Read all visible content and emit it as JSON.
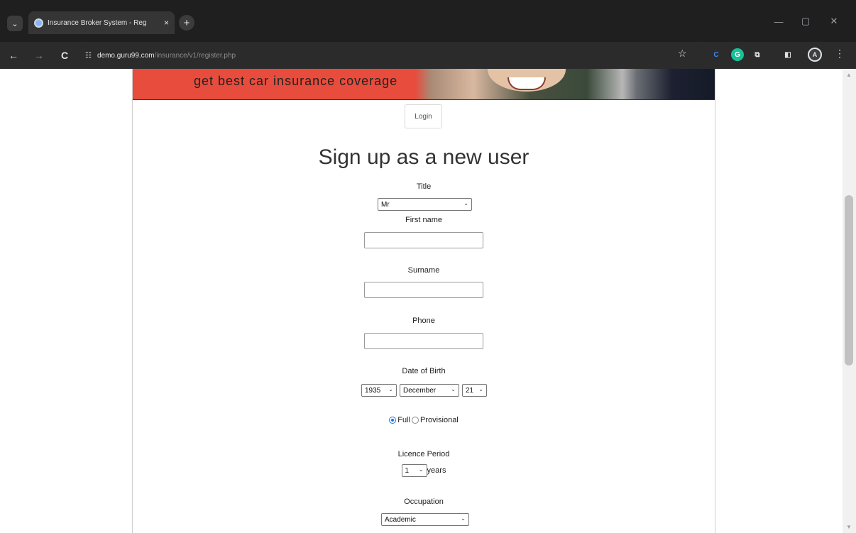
{
  "browser": {
    "tab_title": "Insurance Broker System - Reg",
    "tab_close": "×",
    "new_tab": "+",
    "url_host": "demo.guru99.com",
    "url_path": "/insurance/v1/register.php",
    "icons": {
      "back": "←",
      "forward": "→",
      "reload": "C",
      "site_info": "☷",
      "bookmark": "☆",
      "menu": "⋮",
      "minimize": "—",
      "maximize": "▢",
      "close": "✕"
    },
    "extensions": {
      "c": "C",
      "g": "G",
      "puzzle": "⧉",
      "sidepanel": "◧",
      "avatar": "A"
    }
  },
  "banner": {
    "text": "get best car insurance coverage",
    "color": "#e74c3c"
  },
  "login_button": "Login",
  "heading": "Sign up as a new user",
  "form": {
    "title_label": "Title",
    "title_value": "Mr",
    "first_name_label": "First name",
    "first_name_value": "",
    "surname_label": "Surname",
    "surname_value": "",
    "phone_label": "Phone",
    "phone_value": "",
    "dob_label": "Date of Birth",
    "dob_year": "1935",
    "dob_month": "December",
    "dob_day": "21",
    "licence_type_full": "Full",
    "licence_type_provisional": "Provisional",
    "licence_type_selected": "Full",
    "licence_period_label": "Licence Period",
    "licence_period_value": "1",
    "licence_period_unit": "years",
    "occupation_label": "Occupation",
    "occupation_value": "Academic"
  },
  "chevron": "⌄"
}
